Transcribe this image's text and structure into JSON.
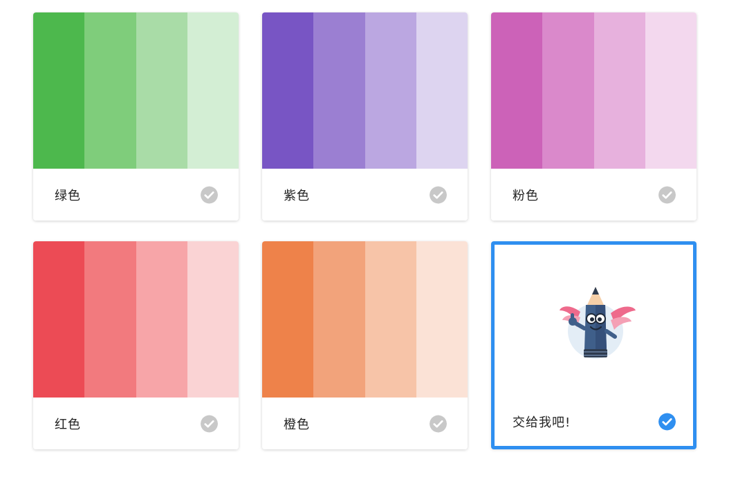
{
  "cards": [
    {
      "label": "绿色",
      "selected": false,
      "colors": [
        "#4db84d",
        "#7fcd7b",
        "#a9dca7",
        "#d3eed4"
      ]
    },
    {
      "label": "紫色",
      "selected": false,
      "colors": [
        "#7855c4",
        "#9b7fd2",
        "#bba7e1",
        "#ddd4f0"
      ]
    },
    {
      "label": "粉色",
      "selected": false,
      "colors": [
        "#cc62b8",
        "#da89cb",
        "#e7b1dd",
        "#f3d8ee"
      ]
    },
    {
      "label": "红色",
      "selected": false,
      "colors": [
        "#ec4b55",
        "#f27a7e",
        "#f7a5a8",
        "#fad3d4"
      ]
    },
    {
      "label": "橙色",
      "selected": false,
      "colors": [
        "#ee824a",
        "#f2a37b",
        "#f7c4a8",
        "#fbe2d6"
      ]
    },
    {
      "label": "交给我吧!",
      "selected": true,
      "icon": "pencil-mascot-icon"
    }
  ],
  "colors": {
    "check_inactive": "#c8c8c8",
    "check_active": "#2f8ff0",
    "selected_border": "#2f8ff0"
  }
}
